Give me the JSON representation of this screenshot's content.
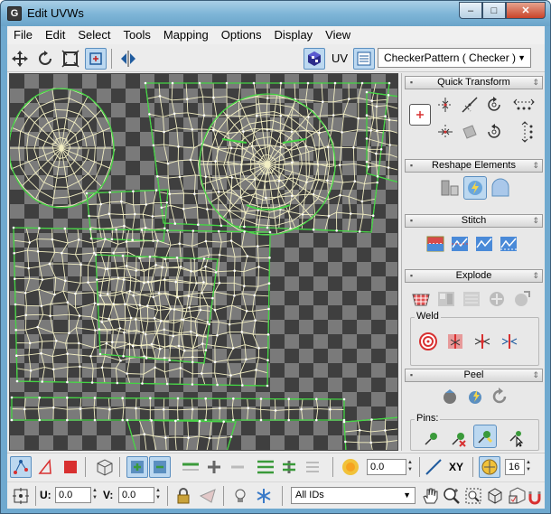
{
  "window": {
    "title": "Edit UVWs",
    "controls": {
      "minimize": "–",
      "maximize": "□",
      "close": "✕"
    }
  },
  "menu": [
    "File",
    "Edit",
    "Select",
    "Tools",
    "Mapping",
    "Options",
    "Display",
    "View"
  ],
  "toolbar": {
    "uv_label": "UV",
    "texture_selected": "CheckerPattern  ( Checker )"
  },
  "panel": {
    "quick_transform": "Quick Transform",
    "reshape": "Reshape Elements",
    "stitch": "Stitch",
    "explode": "Explode",
    "weld_label": "Weld",
    "peel": "Peel",
    "pins_label": "Pins:"
  },
  "bottom": {
    "rotate_value": "0.0",
    "xy_label": "XY",
    "grid_value": "16",
    "u_label": "U:",
    "u_value": "0.0",
    "v_label": "V:",
    "v_value": "0.0",
    "ids_selected": "All IDs"
  },
  "colors": {
    "mesh_line": "#f3efc4",
    "seam": "#44d444",
    "checker_dark": "#3f3f3f",
    "checker_light": "#7a7a7a",
    "accent_blue": "#5b8fc0",
    "selection_red": "#d83030"
  }
}
